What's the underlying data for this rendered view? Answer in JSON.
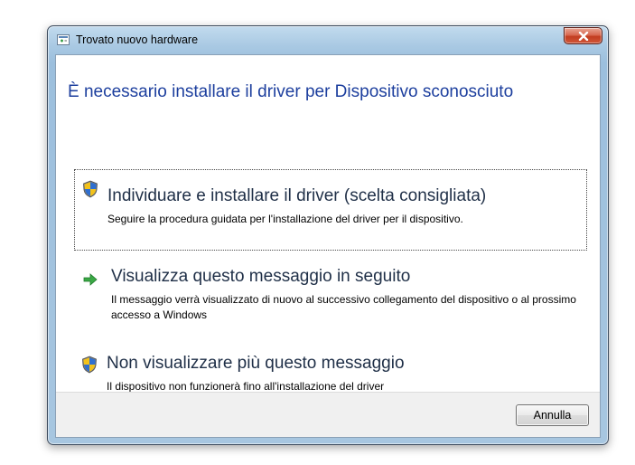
{
  "window": {
    "title": "Trovato nuovo hardware",
    "close_icon": "close-x-icon",
    "icon": "hardware-wizard-icon"
  },
  "content": {
    "header": "È necessario installare il driver per Dispositivo sconosciuto",
    "header_color": "#1d3f9e"
  },
  "options": [
    {
      "icon": "uac-shield-icon",
      "title": "Individuare e installare il driver (scelta consigliata)",
      "description": "Seguire la procedura guidata per l'installazione del driver per il dispositivo.",
      "selected": true
    },
    {
      "icon": "green-arrow-icon",
      "title": "Visualizza questo messaggio in seguito",
      "description": "Il messaggio verrà visualizzato di nuovo al successivo collegamento del dispositivo o al prossimo accesso a Windows",
      "selected": false
    },
    {
      "icon": "uac-shield-icon",
      "title": "Non visualizzare più questo messaggio",
      "description": "Il dispositivo non funzionerà fino all'installazione del driver",
      "selected": false
    }
  ],
  "footer": {
    "cancel_label": "Annulla"
  }
}
